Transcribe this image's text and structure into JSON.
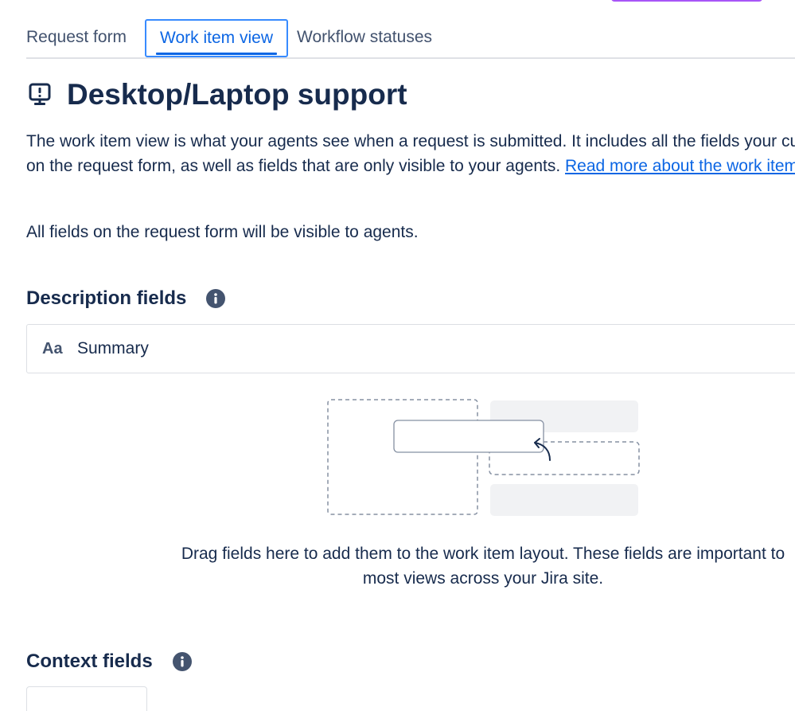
{
  "tabs": [
    {
      "label": "Request form",
      "active": false
    },
    {
      "label": "Work item view",
      "active": true
    },
    {
      "label": "Workflow statuses",
      "active": false
    }
  ],
  "page": {
    "title": "Desktop/Laptop support",
    "title_icon": "monitor-icon",
    "intro_text": "The work item view is what your agents see when a request is submitted. It includes all the fields your customers see on the request form, as well as fields that are only visible to your agents. ",
    "intro_link": "Read more about the work item view",
    "visible_note": "All fields on the request form will be visible to agents."
  },
  "description_section": {
    "heading": "Description fields",
    "fields": [
      {
        "icon_text": "Aa",
        "label": "Summary"
      }
    ],
    "drop_hint": "Drag fields here to add them to the work item layout. These fields are important to most views across your Jira site."
  },
  "context_section": {
    "heading": "Context fields"
  },
  "colors": {
    "link": "#0c66e4",
    "active_tab_border": "#388bff",
    "text": "#172b4d",
    "accent_purple": "#a855f7"
  }
}
